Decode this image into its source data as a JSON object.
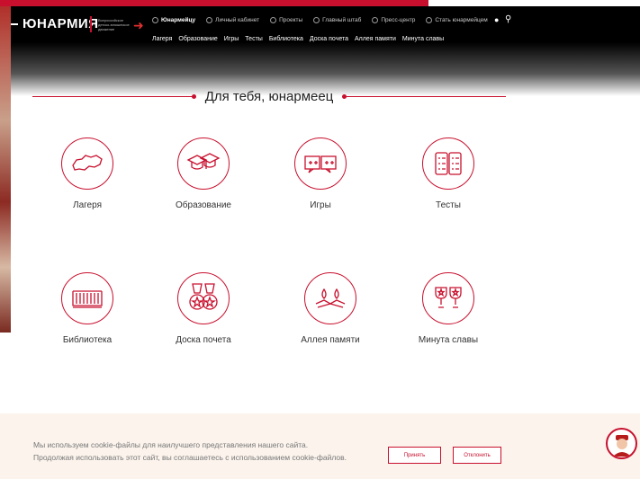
{
  "colors": {
    "accent": "#c8102e",
    "header_bg": "#000000",
    "cookie_bg": "#fbf3ec"
  },
  "header": {
    "logo_text": "ЮНАРМИЯ",
    "logo_subtitle": "Всероссийское детско-юношеское движение",
    "top_nav": [
      {
        "label": "Юнармейцу",
        "icon": "circle-icon",
        "active": true
      },
      {
        "label": "Личный кабинет",
        "icon": "circle-icon"
      },
      {
        "label": "Проекты",
        "icon": "circle-icon"
      },
      {
        "label": "Главный штаб",
        "icon": "circle-icon"
      },
      {
        "label": "Пресс-центр",
        "icon": "circle-icon"
      },
      {
        "label": "Стать юнармейцем",
        "icon": "circle-icon"
      }
    ],
    "main_nav": [
      "Лагеря",
      "Образование",
      "Игры",
      "Тесты",
      "Библиотека",
      "Доска почета",
      "Аллея памяти",
      "Минута славы"
    ],
    "icons": [
      "location-pin-icon",
      "search-icon"
    ]
  },
  "section_title": "Для тебя, юнармеец",
  "tiles": [
    {
      "label": "Лагеря",
      "icon": "russia-map-icon"
    },
    {
      "label": "Образование",
      "icon": "graduation-caps-icon"
    },
    {
      "label": "Игры",
      "icon": "game-cards-icon"
    },
    {
      "label": "Тесты",
      "icon": "test-sheets-icon"
    },
    {
      "label": "Библиотека",
      "icon": "books-icon"
    },
    {
      "label": "Доска почета",
      "icon": "medals-icon"
    },
    {
      "label": "Аллея памяти",
      "icon": "eternal-flame-icon"
    },
    {
      "label": "Минута славы",
      "icon": "trophy-cups-icon"
    }
  ],
  "cookie": {
    "line1": "Мы используем cookie-файлы для наилучшего представления нашего сайта.",
    "line2": "Продолжая использовать этот сайт, вы соглашаетесь с  использованием cookie-файлов.",
    "accept": "Принять",
    "reject": "Отклонить"
  },
  "assistant_icon": "assistant-avatar-icon"
}
